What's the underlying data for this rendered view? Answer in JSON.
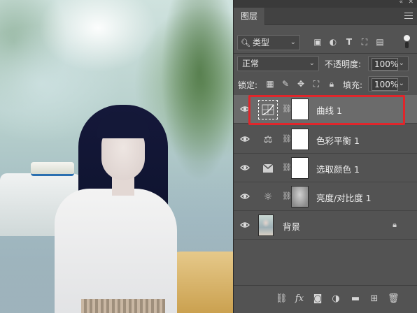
{
  "panel": {
    "tab_label": "图层",
    "filter": {
      "label": "类型",
      "icons": [
        "image-filter-icon",
        "adjustment-filter-icon",
        "type-filter-icon",
        "shape-filter-icon",
        "smart-object-filter-icon"
      ]
    },
    "blend_mode": "正常",
    "opacity_label": "不透明度:",
    "opacity_value": "100%",
    "lock_label": "锁定:",
    "fill_label": "填充:",
    "fill_value": "100%"
  },
  "layers": [
    {
      "name": "曲线 1",
      "type": "curves-adjustment-icon",
      "selected": true
    },
    {
      "name": "色彩平衡 1",
      "type": "color-balance-icon",
      "selected": false
    },
    {
      "name": "选取颜色 1",
      "type": "selective-color-icon",
      "selected": false
    },
    {
      "name": "亮度/对比度 1",
      "type": "brightness-contrast-icon",
      "selected": false
    },
    {
      "name": "背景",
      "type": "background-photo",
      "selected": false,
      "locked": true
    }
  ],
  "colors": {
    "panel_bg": "#535353",
    "selected_row": "#6b6b6b",
    "highlight_frame": "#e0262b"
  }
}
